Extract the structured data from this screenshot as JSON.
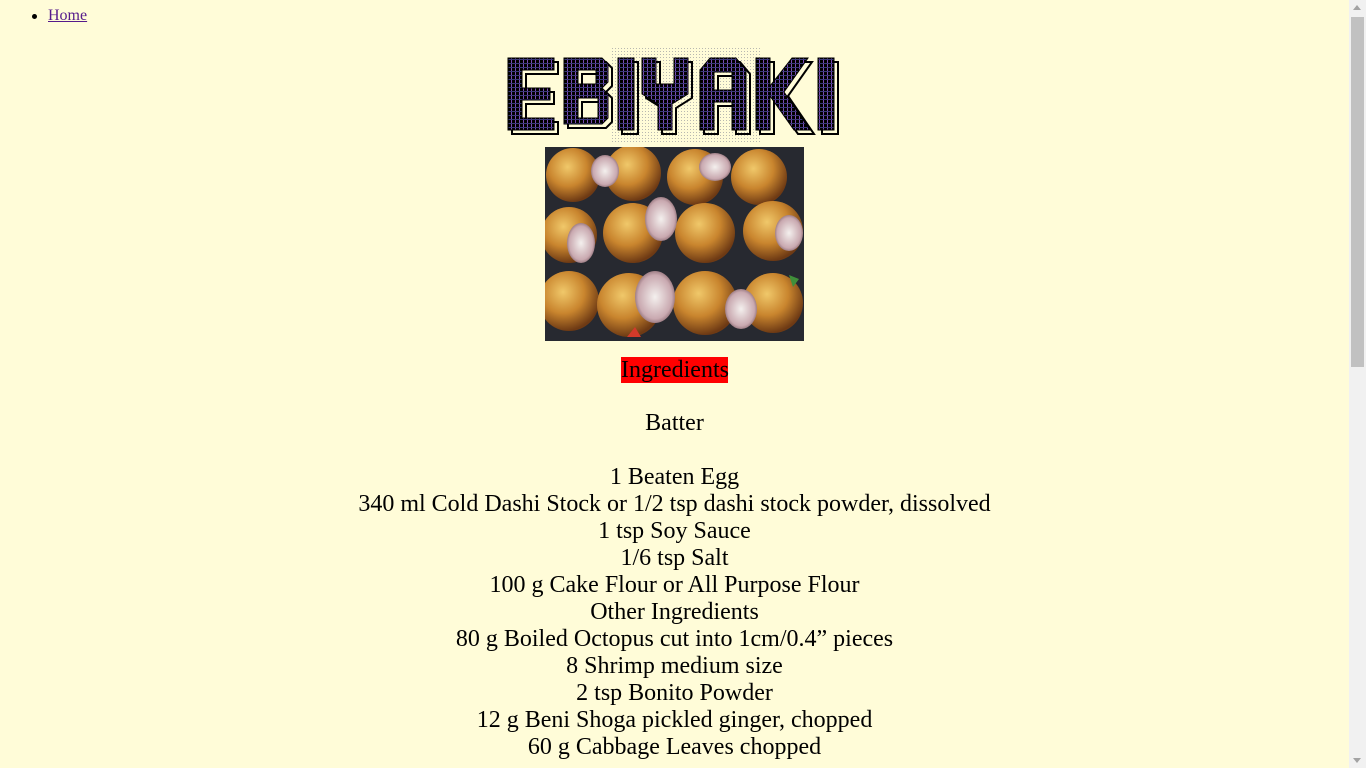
{
  "nav": {
    "items": [
      {
        "label": "Home"
      }
    ]
  },
  "logo": {
    "text": "EBIYAKI"
  },
  "photo": {
    "icon": "takoyaki-photo"
  },
  "recipe": {
    "ingredients_heading": "Ingredients",
    "batter_heading": "Batter",
    "batter_items": [
      "1 Beaten Egg",
      "340 ml Cold Dashi Stock or 1/2 tsp dashi stock powder, dissolved",
      "1 tsp Soy Sauce",
      "1/6 tsp Salt",
      "100 g Cake Flour or All Purpose Flour"
    ],
    "other_heading": "Other Ingredients",
    "other_items": [
      "80 g Boiled Octopus cut into 1cm/0.4” pieces",
      "8 Shrimp medium size",
      "2 tsp Bonito Powder",
      "12 g Beni Shoga pickled ginger, chopped",
      "60 g Cabbage Leaves chopped"
    ]
  },
  "colors": {
    "page_background": "#fffcd8",
    "heading_highlight": "#ff0000",
    "link": "#551a8b"
  }
}
